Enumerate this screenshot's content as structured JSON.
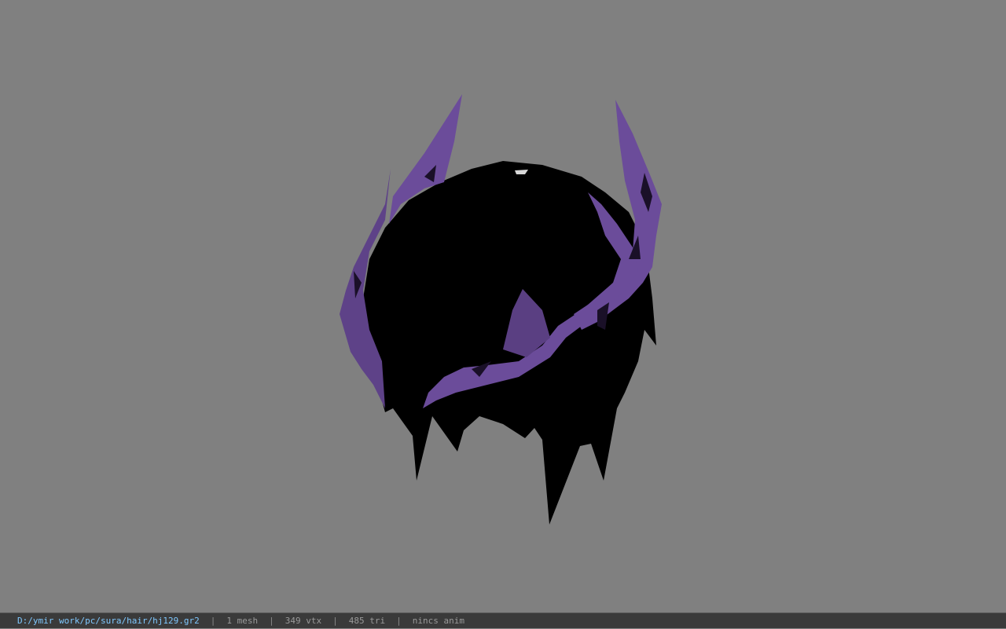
{
  "viewport": {
    "background_color": "#808080",
    "model_colors": {
      "base": "#000000",
      "accent": "#6b4c9a",
      "accent_dark": "#2a1a45"
    }
  },
  "statusbar": {
    "file_path": "D:/ymir work/pc/sura/hair/hj129.gr2",
    "mesh_count": "1 mesh",
    "vertex_count": "349 vtx",
    "triangle_count": "485 tri",
    "anim_status": "nincs anim",
    "separator": "|",
    "path_color": "#7fc8ff"
  }
}
